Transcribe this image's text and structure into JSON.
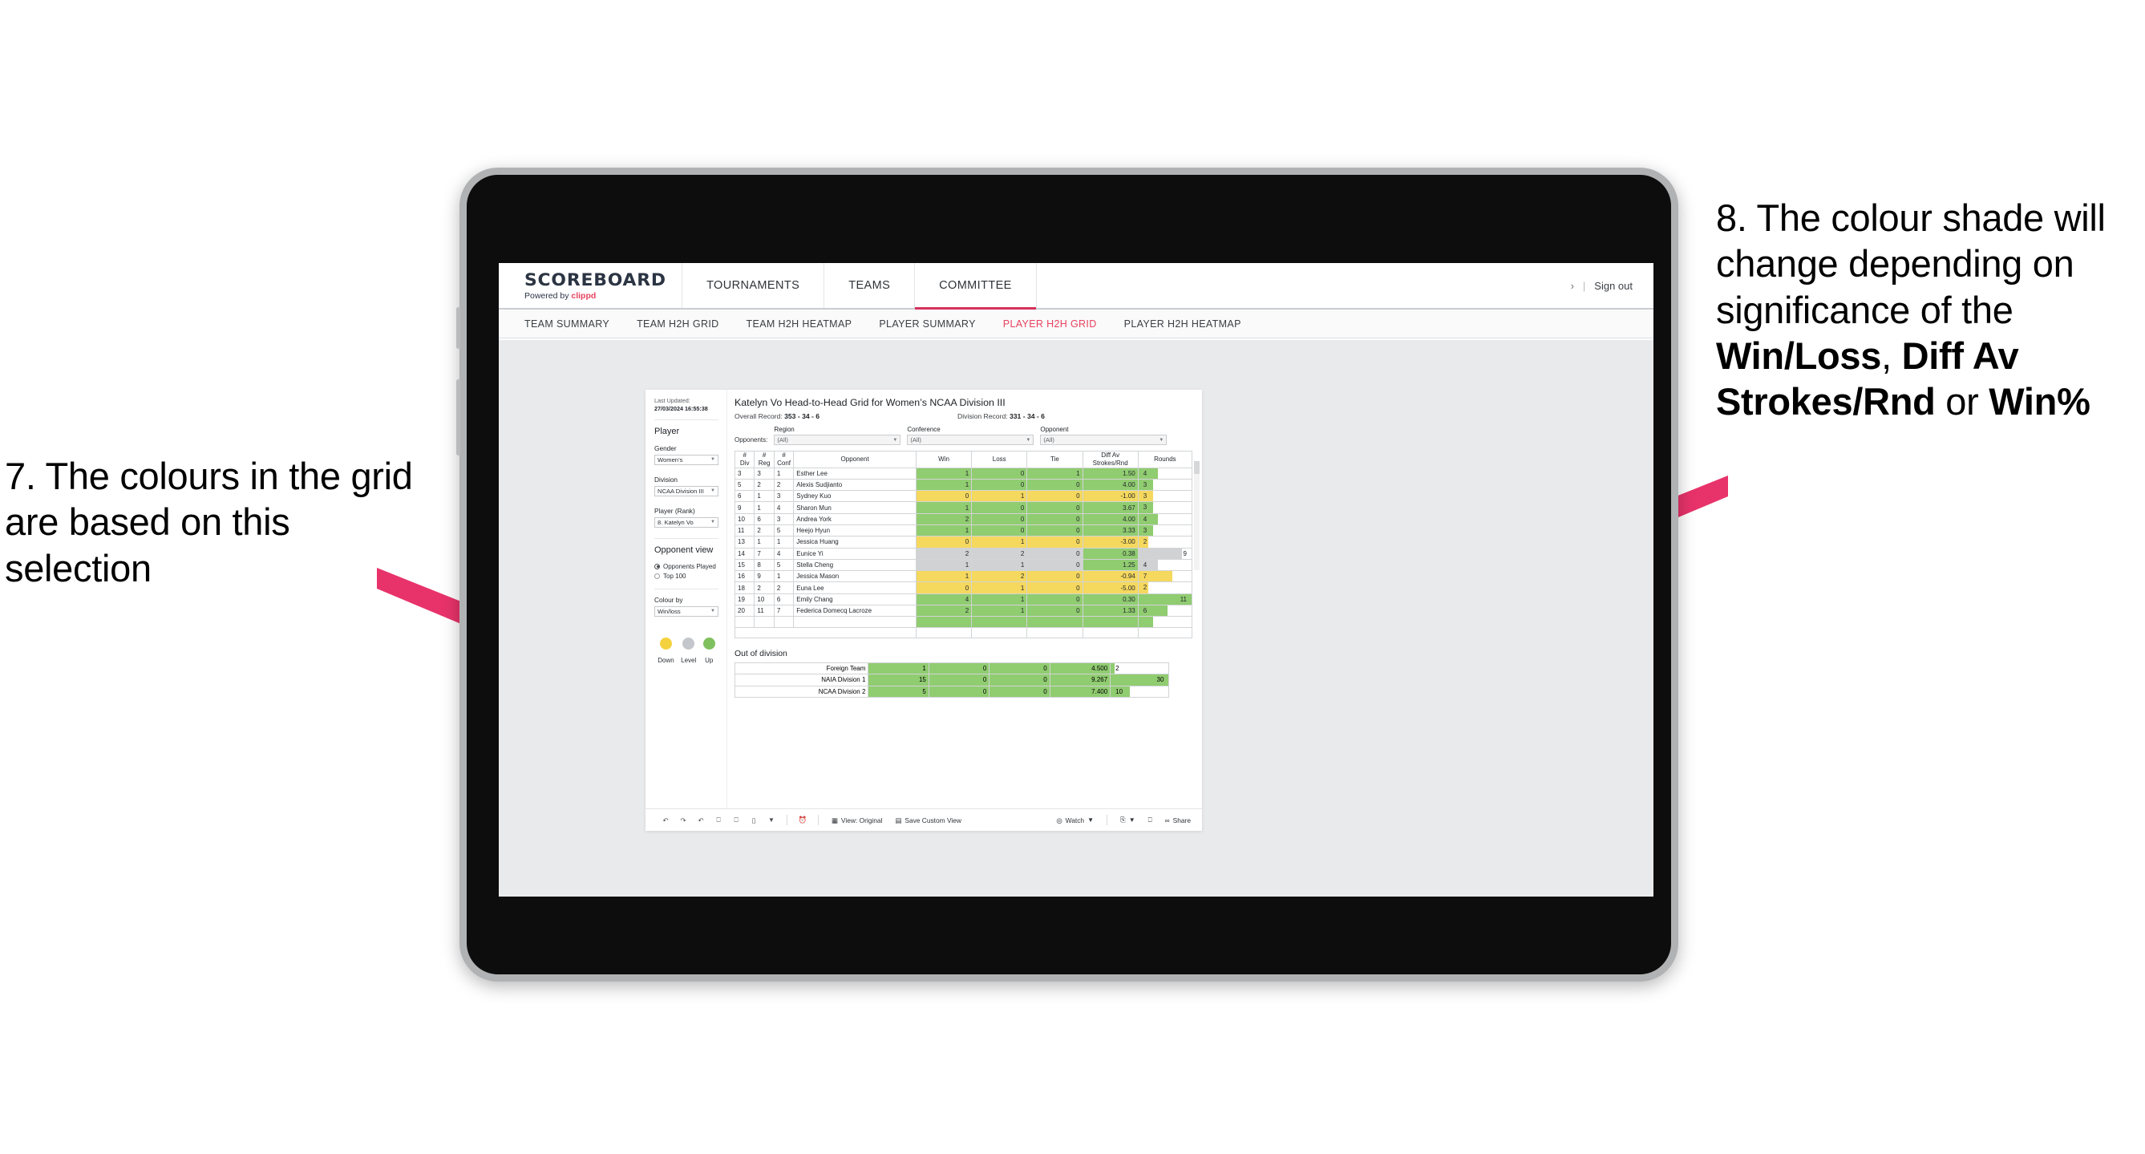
{
  "annotations": {
    "left": {
      "text": "7. The colours in the grid are based on this selection"
    },
    "right": {
      "lead": "8. The colour shade will change depending on significance of the ",
      "bold1": "Win/Loss",
      "mid1": ", ",
      "bold2": "Diff Av Strokes/Rnd",
      "mid2": " or ",
      "bold3": "Win%"
    },
    "accent_color": "#e8336a"
  },
  "app": {
    "brand": {
      "title": "SCOREBOARD",
      "powered_prefix": "Powered by ",
      "powered_name": "clippd"
    },
    "nav_tabs": [
      {
        "label": "TOURNAMENTS",
        "active": false
      },
      {
        "label": "TEAMS",
        "active": false
      },
      {
        "label": "COMMITTEE",
        "active": true
      }
    ],
    "header_right": {
      "chevron": "›",
      "separator": "|",
      "sign_out": "Sign out"
    },
    "subnav": [
      {
        "label": "TEAM SUMMARY",
        "active": false
      },
      {
        "label": "TEAM H2H GRID",
        "active": false
      },
      {
        "label": "TEAM H2H HEATMAP",
        "active": false
      },
      {
        "label": "PLAYER SUMMARY",
        "active": false
      },
      {
        "label": "PLAYER H2H GRID",
        "active": true
      },
      {
        "label": "PLAYER H2H HEATMAP",
        "active": false
      }
    ]
  },
  "sidebar": {
    "last_updated_label": "Last Updated: ",
    "last_updated_value": "27/03/2024 16:55:38",
    "section_title": "Player",
    "fields": [
      {
        "label": "Gender",
        "value": "Women’s"
      },
      {
        "label": "Division",
        "value": "NCAA Division III"
      },
      {
        "label": "Player (Rank)",
        "value": "8. Katelyn Vo"
      }
    ],
    "opponent_view": {
      "title": "Opponent view",
      "options": [
        {
          "label": "Opponents Played",
          "selected": true
        },
        {
          "label": "Top 100",
          "selected": false
        }
      ]
    },
    "colour_by": {
      "label": "Colour by",
      "value": "Win/loss"
    },
    "legend": [
      {
        "label": "Down",
        "color": "#f4d23f"
      },
      {
        "label": "Level",
        "color": "#c3c7cb"
      },
      {
        "label": "Up",
        "color": "#7fc15e"
      }
    ]
  },
  "main": {
    "title": "Katelyn Vo Head-to-Head Grid for Women’s NCAA Division III",
    "overall_record_label": "Overall Record: ",
    "overall_record_value": "353 - 34 - 6",
    "division_record_label": "Division Record: ",
    "division_record_value": "331 - 34 - 6",
    "opponents_label": "Opponents:",
    "filters": [
      {
        "label": "Region",
        "value": "(All)"
      },
      {
        "label": "Conference",
        "value": "(All)"
      },
      {
        "label": "Opponent",
        "value": "(All)"
      }
    ]
  },
  "chart_data": {
    "type": "table",
    "title": "Katelyn Vo Head-to-Head Grid for Women’s NCAA Division III",
    "columns": [
      "# Div",
      "# Reg",
      "# Conf",
      "Opponent",
      "Win",
      "Loss",
      "Tie",
      "Diff Av Strokes/Rnd",
      "Rounds"
    ],
    "column_headers_multiline": [
      [
        "#",
        "Div"
      ],
      [
        "#",
        "Reg"
      ],
      [
        "#",
        "Conf"
      ],
      [
        "Opponent"
      ],
      [
        "Win"
      ],
      [
        "Loss"
      ],
      [
        "Tie"
      ],
      [
        "Diff Av",
        "Strokes/Rnd"
      ],
      [
        "Rounds"
      ]
    ],
    "colors": {
      "up": "#90cc70",
      "down": "#f5d85e",
      "level": "#d0d2d4",
      "bar": "#90cc70"
    },
    "rows": [
      {
        "div": "3",
        "reg": "3",
        "conf": "1",
        "opponent": "Esther Lee",
        "win": "1",
        "loss": "0",
        "tie": "1",
        "diff": "1.50",
        "rounds": "4",
        "state": "up",
        "bar_pct": 36
      },
      {
        "div": "5",
        "reg": "2",
        "conf": "2",
        "opponent": "Alexis Sudjianto",
        "win": "1",
        "loss": "0",
        "tie": "0",
        "diff": "4.00",
        "rounds": "3",
        "state": "up",
        "bar_pct": 27
      },
      {
        "div": "6",
        "reg": "1",
        "conf": "3",
        "opponent": "Sydney Kuo",
        "win": "0",
        "loss": "1",
        "tie": "0",
        "diff": "-1.00",
        "rounds": "3",
        "state": "down",
        "bar_pct": 27
      },
      {
        "div": "9",
        "reg": "1",
        "conf": "4",
        "opponent": "Sharon Mun",
        "win": "1",
        "loss": "0",
        "tie": "0",
        "diff": "3.67",
        "rounds": "3",
        "state": "up",
        "bar_pct": 27
      },
      {
        "div": "10",
        "reg": "6",
        "conf": "3",
        "opponent": "Andrea York",
        "win": "2",
        "loss": "0",
        "tie": "0",
        "diff": "4.00",
        "rounds": "4",
        "state": "up",
        "bar_pct": 36
      },
      {
        "div": "11",
        "reg": "2",
        "conf": "5",
        "opponent": "Heejo Hyun",
        "win": "1",
        "loss": "0",
        "tie": "0",
        "diff": "3.33",
        "rounds": "3",
        "state": "up",
        "bar_pct": 27
      },
      {
        "div": "13",
        "reg": "1",
        "conf": "1",
        "opponent": "Jessica Huang",
        "win": "0",
        "loss": "1",
        "tie": "0",
        "diff": "-3.00",
        "rounds": "2",
        "state": "down",
        "bar_pct": 18
      },
      {
        "div": "14",
        "reg": "7",
        "conf": "4",
        "opponent": "Eunice Yi",
        "win": "2",
        "loss": "2",
        "tie": "0",
        "diff": "0.38",
        "rounds": "9",
        "state": "level",
        "bar_pct": 82,
        "diff_state": "up"
      },
      {
        "div": "15",
        "reg": "8",
        "conf": "5",
        "opponent": "Stella Cheng",
        "win": "1",
        "loss": "1",
        "tie": "0",
        "diff": "1.25",
        "rounds": "4",
        "state": "level",
        "bar_pct": 36,
        "diff_state": "up"
      },
      {
        "div": "16",
        "reg": "9",
        "conf": "1",
        "opponent": "Jessica Mason",
        "win": "1",
        "loss": "2",
        "tie": "0",
        "diff": "-0.94",
        "rounds": "7",
        "state": "down",
        "bar_pct": 64
      },
      {
        "div": "18",
        "reg": "2",
        "conf": "2",
        "opponent": "Euna Lee",
        "win": "0",
        "loss": "1",
        "tie": "0",
        "diff": "-5.00",
        "rounds": "2",
        "state": "down",
        "bar_pct": 18
      },
      {
        "div": "19",
        "reg": "10",
        "conf": "6",
        "opponent": "Emily Chang",
        "win": "4",
        "loss": "1",
        "tie": "0",
        "diff": "0.30",
        "rounds": "11",
        "state": "up",
        "bar_pct": 100
      },
      {
        "div": "20",
        "reg": "11",
        "conf": "7",
        "opponent": "Federica Domecq Lacroze",
        "win": "2",
        "loss": "1",
        "tie": "0",
        "diff": "1.33",
        "rounds": "6",
        "state": "up",
        "bar_pct": 55
      }
    ],
    "out_of_division": {
      "title": "Out of division",
      "rows": [
        {
          "name": "Foreign Team",
          "win": "1",
          "loss": "0",
          "tie": "0",
          "diff": "4.500",
          "rounds": "2",
          "state": "up",
          "bar_pct": 7
        },
        {
          "name": "NAIA Division 1",
          "win": "15",
          "loss": "0",
          "tie": "0",
          "diff": "9.267",
          "rounds": "30",
          "state": "up",
          "bar_pct": 100
        },
        {
          "name": "NCAA Division 2",
          "win": "5",
          "loss": "0",
          "tie": "0",
          "diff": "7.400",
          "rounds": "10",
          "state": "up",
          "bar_pct": 33
        }
      ]
    }
  },
  "toolbar": {
    "icons": [
      "undo-icon",
      "redo-icon",
      "revert-icon",
      "refresh-data-icon",
      "pause-icon",
      "shape-icon",
      "caret-icon"
    ],
    "clock_icon": "history-icon",
    "view_label": "View: Original",
    "save_label": "Save Custom View",
    "watch_label": "Watch",
    "share_label": "Share"
  }
}
